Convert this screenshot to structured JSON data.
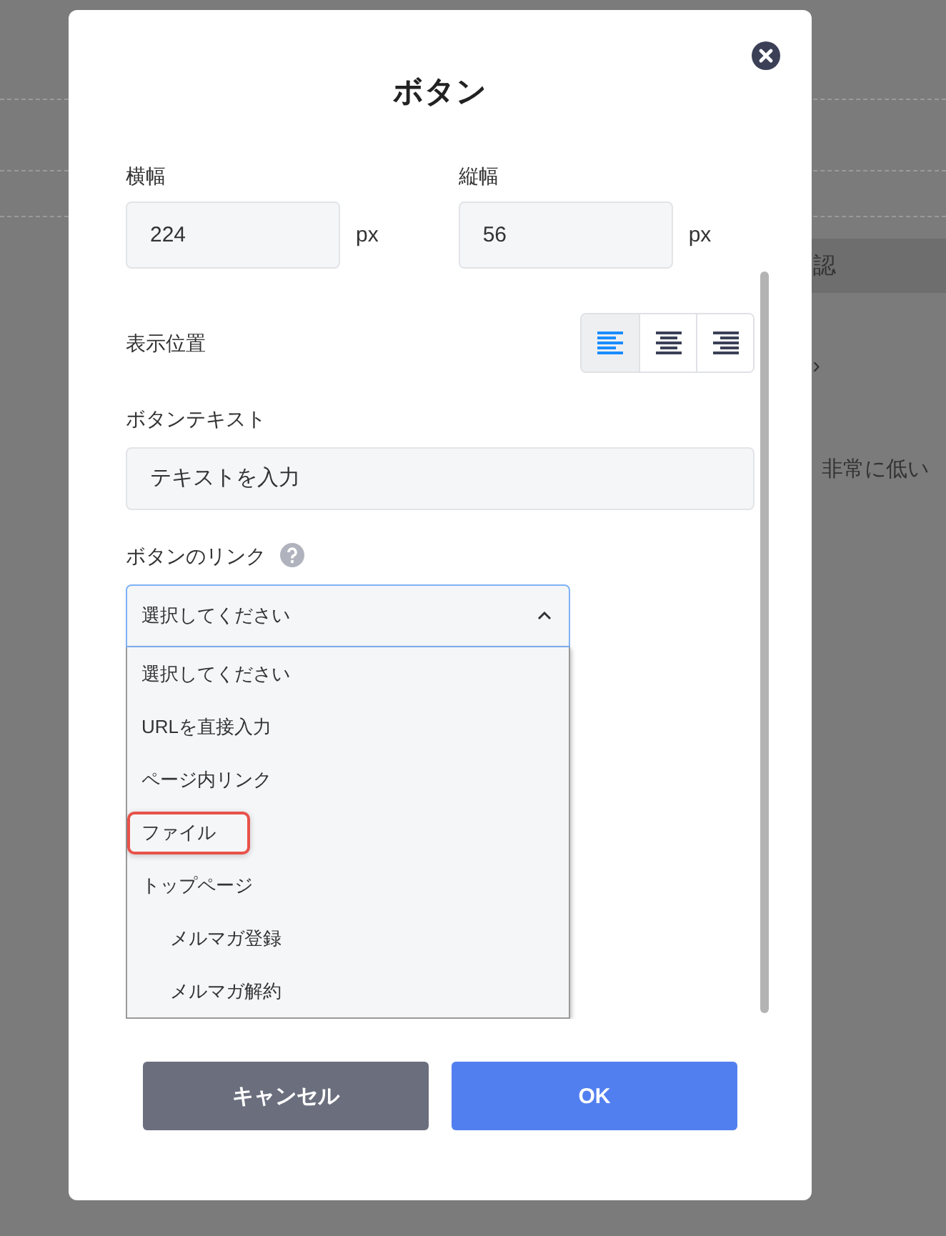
{
  "background": {
    "tab_text": "認",
    "chevron": "›",
    "note": "非常に低い"
  },
  "dialog": {
    "title": "ボタン",
    "width_field": {
      "label": "横幅",
      "value": "224",
      "unit": "px"
    },
    "height_field": {
      "label": "縦幅",
      "value": "56",
      "unit": "px"
    },
    "position": {
      "label": "表示位置",
      "options": [
        {
          "kind": "left",
          "selected": true
        },
        {
          "kind": "center",
          "selected": false
        },
        {
          "kind": "right",
          "selected": false
        }
      ]
    },
    "button_text": {
      "label": "ボタンテキスト",
      "placeholder": "テキストを入力"
    },
    "link": {
      "label": "ボタンのリンク",
      "value": "選択してください",
      "expanded": true,
      "options": [
        {
          "label": "選択してください",
          "annotated": false
        },
        {
          "label": "URLを直接入力",
          "annotated": false
        },
        {
          "label": "ページ内リンク",
          "annotated": false
        },
        {
          "label": "ファイル",
          "annotated": true
        },
        {
          "label": "トップページ",
          "annotated": false,
          "children": [
            {
              "label": "メルマガ登録",
              "annotated": false
            },
            {
              "label": "メルマガ解約",
              "annotated": false
            }
          ]
        }
      ]
    },
    "buttons": [
      {
        "kind": "cancel",
        "label": "キャンセル"
      },
      {
        "kind": "ok",
        "label": "OK"
      }
    ]
  }
}
